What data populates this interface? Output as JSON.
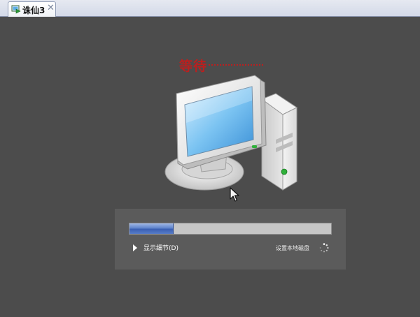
{
  "tab": {
    "title": "诛仙3",
    "close_glyph": "✕",
    "icon": "vm-icon"
  },
  "wait": {
    "label": "等待"
  },
  "illustration": {
    "icon": "computer-icon"
  },
  "progress": {
    "value": 0.22,
    "fill_color": "#4a6fc0"
  },
  "details": {
    "label": "显示细节(D)",
    "icon": "expand-triangle-icon"
  },
  "status": {
    "text": "设置本地磁盘",
    "icon": "loading-spinner-icon"
  },
  "colors": {
    "background": "#4c4c4c",
    "panel": "#5b5b5b",
    "wait_text": "#bb1f1f"
  }
}
